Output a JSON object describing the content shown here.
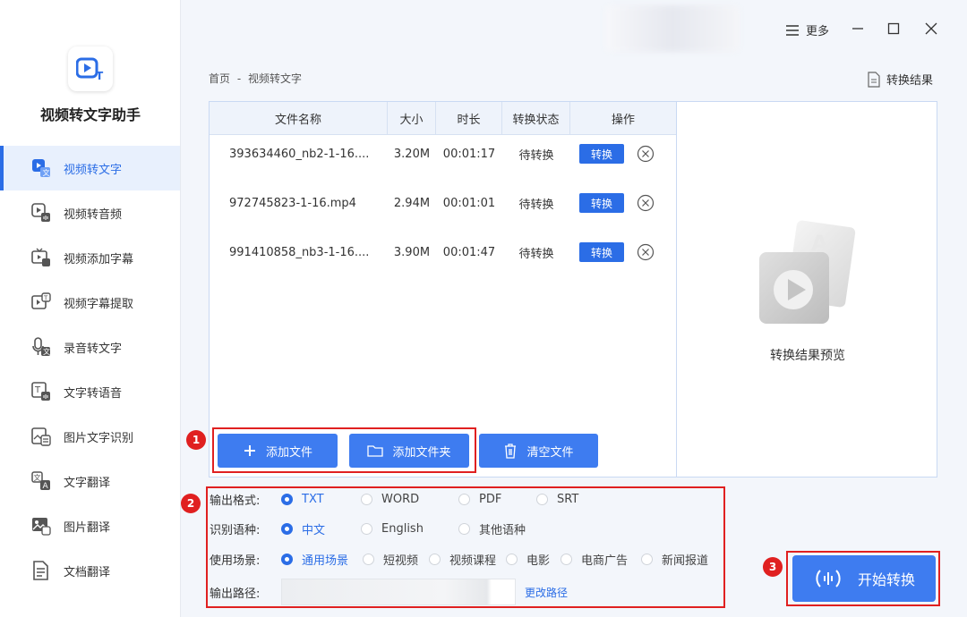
{
  "app": {
    "name": "视频转文字助手"
  },
  "sidebar": {
    "items": [
      {
        "label": "视频转文字",
        "icon": "video-to-text-icon"
      },
      {
        "label": "视频转音频",
        "icon": "video-to-audio-icon"
      },
      {
        "label": "视频添加字幕",
        "icon": "add-subtitle-icon"
      },
      {
        "label": "视频字幕提取",
        "icon": "subtitle-extract-icon"
      },
      {
        "label": "录音转文字",
        "icon": "record-to-text-icon"
      },
      {
        "label": "文字转语音",
        "icon": "text-to-speech-icon"
      },
      {
        "label": "图片文字识别",
        "icon": "image-ocr-icon"
      },
      {
        "label": "文字翻译",
        "icon": "text-translate-icon"
      },
      {
        "label": "图片翻译",
        "icon": "image-translate-icon"
      },
      {
        "label": "文档翻译",
        "icon": "doc-translate-icon"
      }
    ],
    "active_index": 0
  },
  "titlebar": {
    "more_label": "更多"
  },
  "breadcrumb": {
    "home": "首页",
    "separator": "-",
    "current": "视频转文字"
  },
  "result_link": "转换结果",
  "table": {
    "headers": [
      "文件名称",
      "大小",
      "时长",
      "转换状态",
      "操作"
    ],
    "rows": [
      {
        "name": "393634460_nb2-1-16....",
        "size": "3.20M",
        "duration": "00:01:17",
        "status": "待转换",
        "action": "转换"
      },
      {
        "name": "972745823-1-16.mp4",
        "size": "2.94M",
        "duration": "00:01:01",
        "status": "待转换",
        "action": "转换"
      },
      {
        "name": "991410858_nb3-1-16....",
        "size": "3.90M",
        "duration": "00:01:47",
        "status": "待转换",
        "action": "转换"
      }
    ]
  },
  "preview": {
    "label": "转换结果预览"
  },
  "actions": {
    "add_file": "添加文件",
    "add_folder": "添加文件夹",
    "clear_files": "清空文件"
  },
  "badges": {
    "one": "1",
    "two": "2",
    "three": "3"
  },
  "settings": {
    "format": {
      "label": "输出格式:",
      "options": [
        "TXT",
        "WORD",
        "PDF",
        "SRT"
      ],
      "selected": "TXT"
    },
    "language": {
      "label": "识别语种:",
      "options": [
        "中文",
        "English",
        "其他语种"
      ],
      "selected": "中文"
    },
    "scene": {
      "label": "使用场景:",
      "options": [
        "通用场景",
        "短视频",
        "视频课程",
        "电影",
        "电商广告",
        "新闻报道"
      ],
      "selected": "通用场景"
    },
    "path": {
      "label": "输出路径:",
      "change_label": "更改路径"
    }
  },
  "start_button": "开始转换",
  "colors": {
    "accent": "#2b6de6",
    "button": "#3e7cf0",
    "highlight": "#e02020"
  }
}
